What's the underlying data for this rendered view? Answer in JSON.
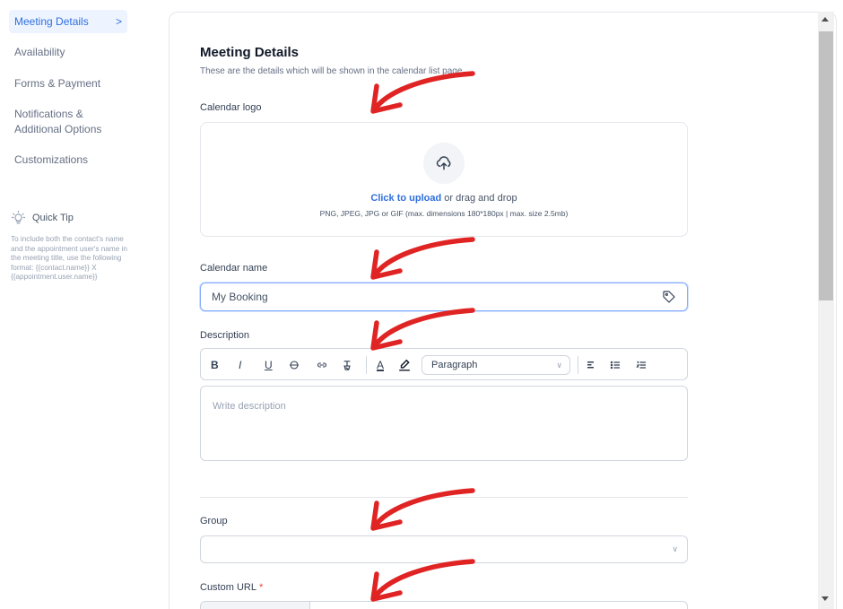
{
  "sidebar": {
    "items": [
      {
        "label": "Meeting Details",
        "active": true
      },
      {
        "label": "Availability"
      },
      {
        "label": "Forms & Payment"
      },
      {
        "label": "Notifications &"
      },
      {
        "label": "Additional Options"
      },
      {
        "label": "Customizations"
      }
    ],
    "quick_tip": {
      "title": "Quick Tip",
      "text": "To include both the contact's name and the appointment user's name in the meeting title, use the following format: {{contact.name}} X {{appointment.user.name}}"
    }
  },
  "main": {
    "title": "Meeting Details",
    "subtitle": "These are the details which will be shown in the calendar list page.",
    "logo": {
      "label": "Calendar logo",
      "link_text": "Click to upload",
      "rest_text": " or drag and drop",
      "hint": "PNG, JPEG, JPG or GIF (max. dimensions 180*180px | max. size 2.5mb)",
      "icon": "cloud-upload-icon"
    },
    "calendar_name": {
      "label": "Calendar name",
      "value": "My Booking",
      "icon": "tag-icon"
    },
    "description": {
      "label": "Description",
      "toolbar": {
        "bold": "B",
        "italic": "I",
        "underline": "U",
        "font_color": "A",
        "paragraph": "Paragraph"
      },
      "placeholder": "Write description"
    },
    "group": {
      "label": "Group"
    },
    "custom_url": {
      "label": "Custom URL",
      "required_mark": "*"
    }
  },
  "colors": {
    "accent": "#2f6fde",
    "arrow": "#e02424",
    "required": "#f04438"
  }
}
